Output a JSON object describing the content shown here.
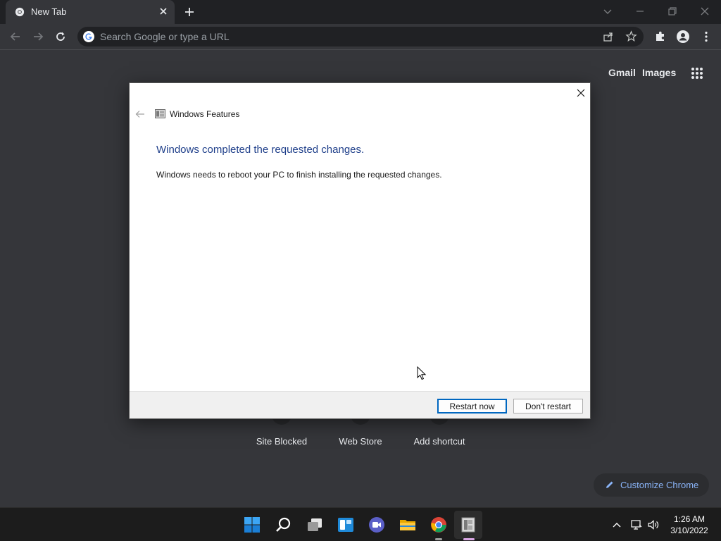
{
  "browser": {
    "tab_title": "New Tab",
    "omnibox_placeholder": "Search Google or type a URL"
  },
  "ntp": {
    "top_links": [
      "Gmail",
      "Images"
    ],
    "shortcuts": [
      "Site Blocked",
      "Web Store",
      "Add shortcut"
    ],
    "customize_label": "Customize Chrome"
  },
  "dialog": {
    "app_title": "Windows Features",
    "heading": "Windows completed the requested changes.",
    "message": "Windows needs to reboot your PC to finish installing the requested changes.",
    "buttons": {
      "primary": "Restart now",
      "secondary": "Don't restart"
    }
  },
  "taskbar": {
    "pinned": [
      "start-icon",
      "search-icon",
      "task-view-icon",
      "widgets-icon",
      "teams-chat-icon",
      "file-explorer-icon",
      "chrome-icon",
      "windows-features-icon"
    ],
    "clock": {
      "time": "1:26 AM",
      "date": "3/10/2022"
    }
  },
  "colors": {
    "chrome_dark": "#35363a",
    "tabstrip": "#202124",
    "accent_blue": "#8ab4f8",
    "dialog_heading": "#1f3f8a",
    "win_accent": "#0067c0"
  }
}
